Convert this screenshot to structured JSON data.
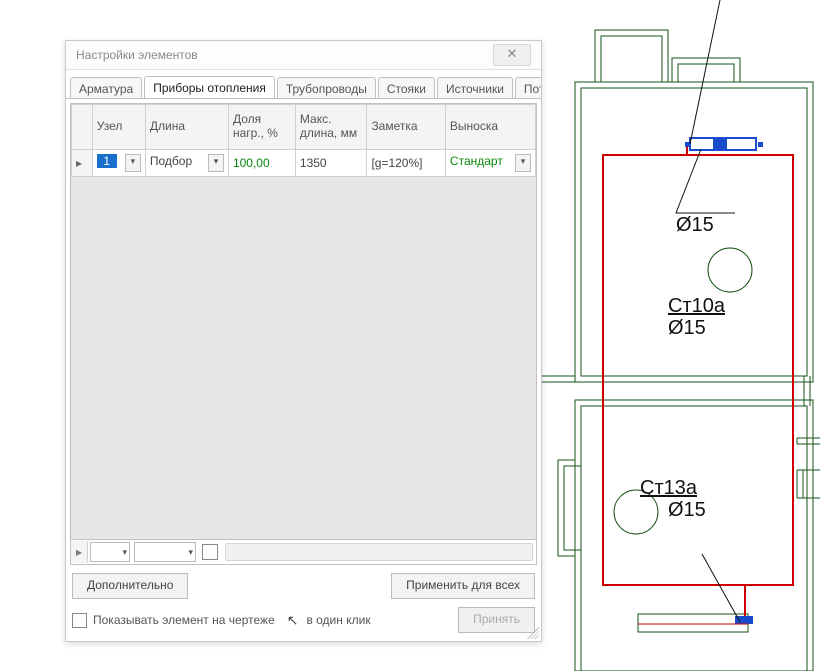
{
  "dialog": {
    "title": "Настройки элементов",
    "close_glyph": "✕"
  },
  "tabs": {
    "items": [
      {
        "id": "armatura",
        "label": "Арматура"
      },
      {
        "id": "pribory",
        "label": "Приборы отопления"
      },
      {
        "id": "trubo",
        "label": "Трубопроводы"
      },
      {
        "id": "stoyaki",
        "label": "Стояки"
      },
      {
        "id": "istochniki",
        "label": "Источники"
      },
      {
        "id": "potrebiteli",
        "label": "Потребители"
      }
    ],
    "active_index": 1,
    "scroll_left": "◄",
    "scroll_right": "►"
  },
  "grid": {
    "columns": [
      {
        "id": "uzel",
        "label": "Узел"
      },
      {
        "id": "dlina",
        "label": "Длина"
      },
      {
        "id": "dolya",
        "label": "Доля нагр., %"
      },
      {
        "id": "maxdlina",
        "label": "Макс. длина, мм"
      },
      {
        "id": "zametka",
        "label": "Заметка"
      },
      {
        "id": "vynoska",
        "label": "Выноска"
      }
    ],
    "row_indicator": "▸",
    "row": {
      "uzel": "1",
      "dlina": "Подбор",
      "dolya": "100,00",
      "maxdlina": "1350",
      "zametka": "[g=120%]",
      "vynoska": "Стандарт"
    },
    "dd_glyph": "▾",
    "filter_indicator": "▸"
  },
  "buttons": {
    "more": "Дополнительно",
    "apply_all": "Применить для всех",
    "accept": "Принять"
  },
  "bottom": {
    "show_on_drawing": "Показывать элемент на чертеже",
    "cursor_glyph": "↖",
    "one_click": "в один клик"
  },
  "drawing": {
    "labels": {
      "o15a": "Ø15",
      "st10a": "Ст10а",
      "o15b": "Ø15",
      "st13a": "Ст13а",
      "o15c": "Ø15"
    }
  }
}
